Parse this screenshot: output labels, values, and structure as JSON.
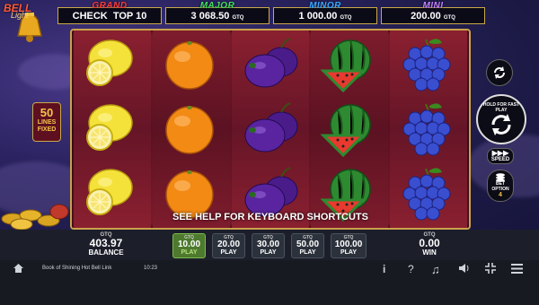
{
  "logo": {
    "text": "BELL Light"
  },
  "jackpots": [
    {
      "title": "GRAND",
      "value": "CHECK  TOP 10",
      "currency": "",
      "title_color": "#ff3b3b"
    },
    {
      "title": "MAJOR",
      "value": "3 068.50",
      "currency": "GTQ",
      "title_color": "#3ee05a"
    },
    {
      "title": "MINOR",
      "value": "1 000.00",
      "currency": "GTQ",
      "title_color": "#3aa8ff"
    },
    {
      "title": "MINI",
      "value": "200.00",
      "currency": "GTQ",
      "title_color": "#c080ff"
    }
  ],
  "lines_badge": {
    "number": "50",
    "text1": "LINES",
    "text2": "FIXED"
  },
  "reels": [
    [
      "lemon-icon",
      "lemon-icon",
      "lemon-icon"
    ],
    [
      "orange-icon",
      "orange-icon",
      "orange-icon"
    ],
    [
      "plum-icon",
      "plum-icon",
      "plum-icon"
    ],
    [
      "watermelon-icon",
      "watermelon-icon",
      "watermelon-icon"
    ],
    [
      "grapes-icon",
      "grapes-icon",
      "grapes-icon"
    ]
  ],
  "help_text": "SEE HELP FOR KEYBOARD SHORTCUTS",
  "controls": {
    "hold_text": "HOLD FOR FAST PLAY",
    "speed_label": "SPEED",
    "bet_option_label1": "BET",
    "bet_option_label2": "OPTION",
    "bet_option_value": "4"
  },
  "balance": {
    "currency": "GTQ",
    "value": "403.97",
    "label": "BALANCE"
  },
  "bets": [
    {
      "currency": "GTQ",
      "value": "10.00",
      "label": "PLAY",
      "active": true
    },
    {
      "currency": "GTQ",
      "value": "20.00",
      "label": "PLAY",
      "active": false
    },
    {
      "currency": "GTQ",
      "value": "30.00",
      "label": "PLAY",
      "active": false
    },
    {
      "currency": "GTQ",
      "value": "50.00",
      "label": "PLAY",
      "active": false
    },
    {
      "currency": "GTQ",
      "value": "100.00",
      "label": "PLAY",
      "active": false
    }
  ],
  "win": {
    "currency": "GTQ",
    "value": "0.00",
    "label": "WIN"
  },
  "system_bar": {
    "game_name": "Book of Shining Hot Bell Link",
    "time": "10:23"
  }
}
